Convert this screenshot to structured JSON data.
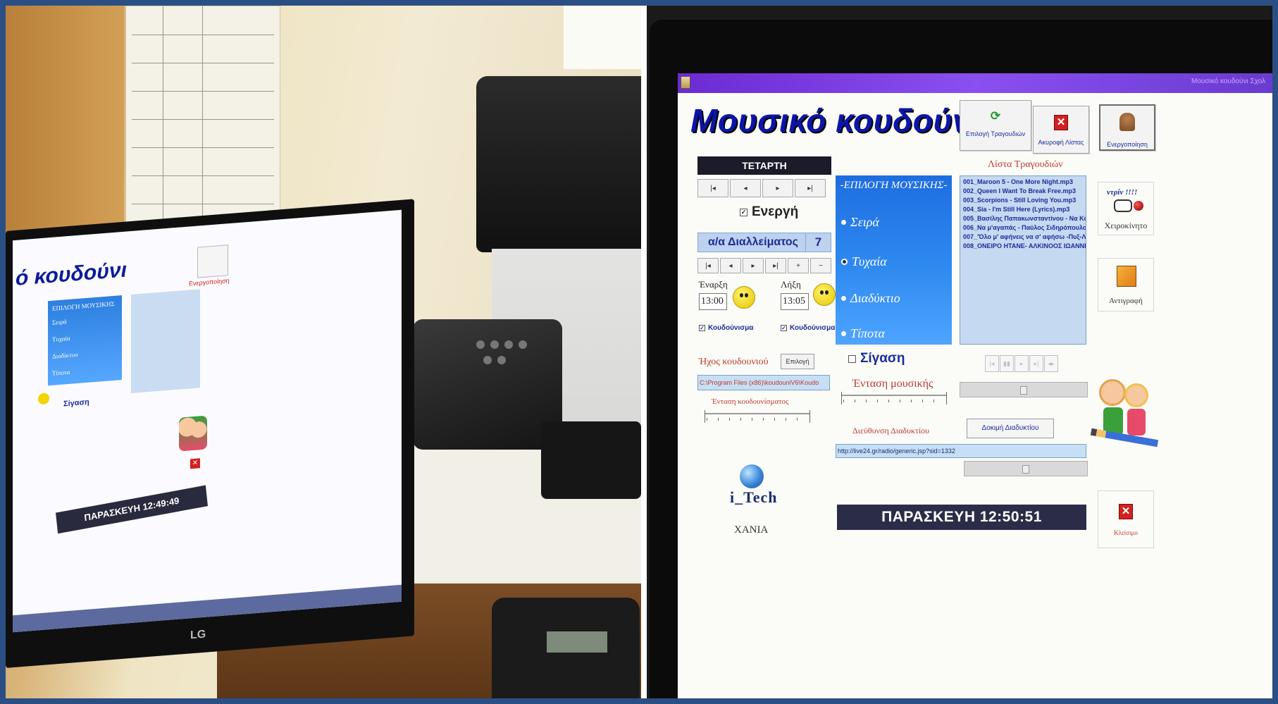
{
  "left_screen": {
    "app_title": "ό κουδούνι",
    "music_panel_head": "ΕΠΙΛΟΓΗ ΜΟΥΣΙΚΗΣ",
    "music_options": [
      "Σειρά",
      "Τυχαία",
      "Διαδίκτυο",
      "Τίποτα"
    ],
    "silence": "Σίγαση",
    "activate_label": "Ενεργοποίηση",
    "clock": "ΠΑΡΑΣΚΕΥΗ  12:49:49",
    "monitor_brand": "LG"
  },
  "app": {
    "title": "Μουσικό κουδούνι",
    "window_caption": "Μουσικό κουδούνι Σχολ",
    "day": "ΤΕΤΑΡΤΗ",
    "nav_buttons_top": [
      "|◂",
      "◂",
      "▸",
      "▸|"
    ],
    "active_checkbox": {
      "checked_mark": "✓",
      "label": "Ενεργή"
    },
    "interval": {
      "label": "α/α Διαλλείματος",
      "value": "7"
    },
    "nav_buttons_bottom": [
      "|◂",
      "◂",
      "▸",
      "▸|",
      "+",
      "−"
    ],
    "start": {
      "label": "Έναρξη",
      "time": "13:00",
      "bell_label": "Κουδούνισμα"
    },
    "end": {
      "label": "Λήξη",
      "time": "13:05",
      "bell_label": "Κουδούνισμα"
    },
    "bell_sound_label": "Ήχος κουδουνιού",
    "select_button": "Επιλογή",
    "bell_path": "C:\\Program Files (x86)\\koudouniV6\\Koudo",
    "bell_volume_label": "Ένταση κουδουνίσματος",
    "logo_text": "i_Tech",
    "city": "ΧΑΝΙΑ",
    "music_panel": {
      "heading": "-ΕΠΙΛΟΓΗ ΜΟΥΣΙΚΗΣ-",
      "options": [
        {
          "label": "Σειρά",
          "selected": false
        },
        {
          "label": "Τυχαία",
          "selected": true
        },
        {
          "label": "Διαδύκτιο",
          "selected": false
        },
        {
          "label": "Τίποτα",
          "selected": false
        }
      ]
    },
    "silence_label": "Σίγαση",
    "music_volume_label": "Ένταση μουσικής",
    "internet_address_label": "Διεύθυνση Διαδυκτίου",
    "test_internet_button": "Δοκιμή Διαδυκτίου",
    "url": "http://live24.gr/radio/generic.jsp?sid=1332",
    "clock": "ΠΑΡΑΣΚΕΥΗ  12:50:51",
    "toolbar": {
      "select_songs": "Επιλογή Τραγουδιών",
      "cancel_list": "Ακυροφή Λίστας",
      "activate": "Ενεργοποίηση"
    },
    "songs_title": "Λίστα Τραγουδιών",
    "songs": [
      "001_Maroon 5 - One More Night.mp3",
      "002_Queen I Want To Break Free.mp3",
      "003_Scorpions - Still Loving You.mp3",
      "004_Sia - I'm Still Here (Lyrics).mp3",
      "005_Βασίλης Παπακωνσταντίνου - Να Κο",
      "006_Να μ'αγαπάς - Παύλος Σιδηρόπουλος",
      "007_'Όλο μ' αφήνεις να σ' αφήσω -Πυξ-Λ",
      "008_ΟΝΕΙΡΟ ΗΤΑΝΕ- ΑΛΚΙΝΟΟΣ ΙΩΑΝΝΙΔΗ"
    ],
    "player_buttons": [
      "|◂",
      "▮▮",
      "▸",
      "▸|",
      "◂▸"
    ],
    "manual_top": "ντρίν !!!!",
    "manual_label": "Χειροκίνητο",
    "copy_label": "Αντιγραφή",
    "close_label": "Κλείσιμο",
    "close_icon": "✕"
  }
}
